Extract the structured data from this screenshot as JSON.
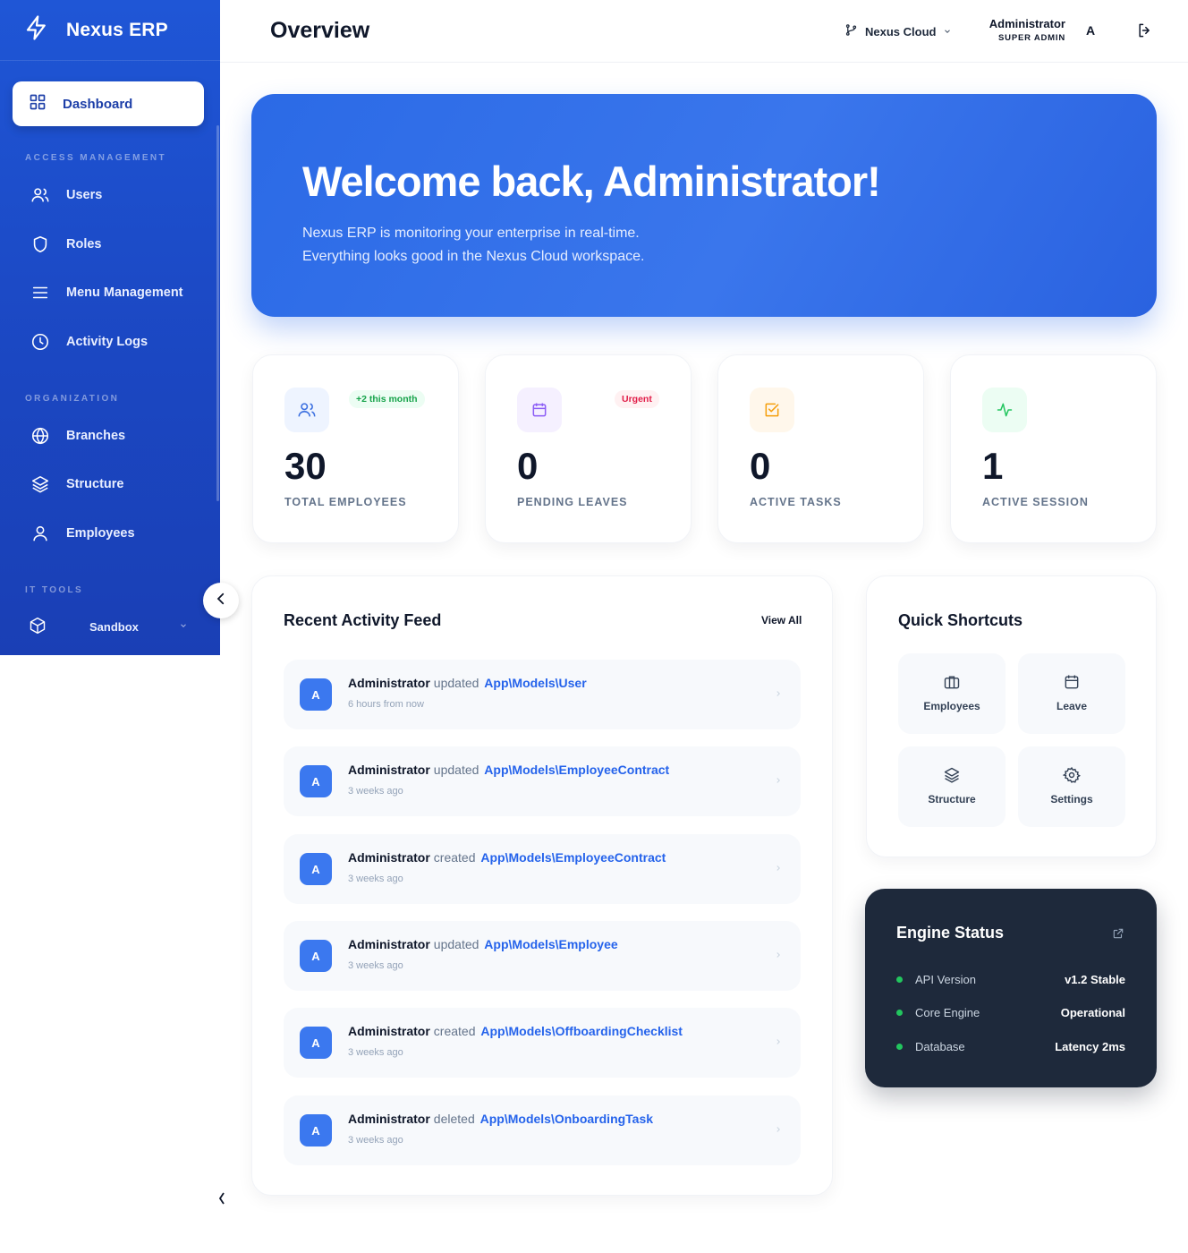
{
  "app": {
    "name": "Nexus ERP"
  },
  "sidebar": {
    "dashboard_label": "Dashboard",
    "sections": [
      {
        "label": "ACCESS MANAGEMENT",
        "items": [
          {
            "label": "Users",
            "icon": "users-icon"
          },
          {
            "label": "Roles",
            "icon": "shield-icon"
          },
          {
            "label": "Menu Management",
            "icon": "menu-icon"
          },
          {
            "label": "Activity Logs",
            "icon": "clock-icon"
          }
        ]
      },
      {
        "label": "ORGANIZATION",
        "items": [
          {
            "label": "Branches",
            "icon": "globe-icon"
          },
          {
            "label": "Structure",
            "icon": "layers-icon"
          },
          {
            "label": "Employees",
            "icon": "user-icon"
          }
        ]
      },
      {
        "label": "IT TOOLS",
        "items": [
          {
            "label": "Sandbox",
            "icon": "cube-icon"
          }
        ]
      }
    ]
  },
  "header": {
    "title": "Overview",
    "workspace": "Nexus Cloud",
    "user_name": "Administrator",
    "user_role": "SUPER ADMIN",
    "user_initial": "A"
  },
  "hero": {
    "title": "Welcome back, Administrator!",
    "line1": "Nexus ERP is monitoring your enterprise in real-time.",
    "line2": "Everything looks good in the Nexus Cloud workspace."
  },
  "stats": [
    {
      "value": "30",
      "label": "TOTAL EMPLOYEES",
      "badge": "+2 this month",
      "icon": "users-icon"
    },
    {
      "value": "0",
      "label": "PENDING LEAVES",
      "badge": "Urgent",
      "icon": "calendar-icon"
    },
    {
      "value": "0",
      "label": "ACTIVE TASKS",
      "badge": "",
      "icon": "check-square-icon"
    },
    {
      "value": "1",
      "label": "ACTIVE SESSION",
      "badge": "",
      "icon": "activity-icon"
    }
  ],
  "feed": {
    "title": "Recent Activity Feed",
    "view_all": "View All",
    "items": [
      {
        "initial": "A",
        "user": "Administrator",
        "action": "updated",
        "model": "App\\Models\\User",
        "time": "6 hours from now"
      },
      {
        "initial": "A",
        "user": "Administrator",
        "action": "updated",
        "model": "App\\Models\\EmployeeContract",
        "time": "3 weeks ago"
      },
      {
        "initial": "A",
        "user": "Administrator",
        "action": "created",
        "model": "App\\Models\\EmployeeContract",
        "time": "3 weeks ago"
      },
      {
        "initial": "A",
        "user": "Administrator",
        "action": "updated",
        "model": "App\\Models\\Employee",
        "time": "3 weeks ago"
      },
      {
        "initial": "A",
        "user": "Administrator",
        "action": "created",
        "model": "App\\Models\\OffboardingChecklist",
        "time": "3 weeks ago"
      },
      {
        "initial": "A",
        "user": "Administrator",
        "action": "deleted",
        "model": "App\\Models\\OnboardingTask",
        "time": "3 weeks ago"
      }
    ]
  },
  "shortcuts": {
    "title": "Quick Shortcuts",
    "items": [
      {
        "label": "Employees",
        "icon": "briefcase-icon"
      },
      {
        "label": "Leave",
        "icon": "calendar-icon"
      },
      {
        "label": "Structure",
        "icon": "layers-icon"
      },
      {
        "label": "Settings",
        "icon": "gear-icon"
      }
    ]
  },
  "engine": {
    "title": "Engine Status",
    "rows": [
      {
        "key": "API Version",
        "value": "v1.2 Stable"
      },
      {
        "key": "Core Engine",
        "value": "Operational"
      },
      {
        "key": "Database",
        "value": "Latency 2ms"
      }
    ]
  },
  "colors": {
    "primary": "#2563eb",
    "sidebar": "#1f4fcf",
    "success": "#22c55e",
    "danger": "#e11d48",
    "dark_card": "#1e293b"
  }
}
